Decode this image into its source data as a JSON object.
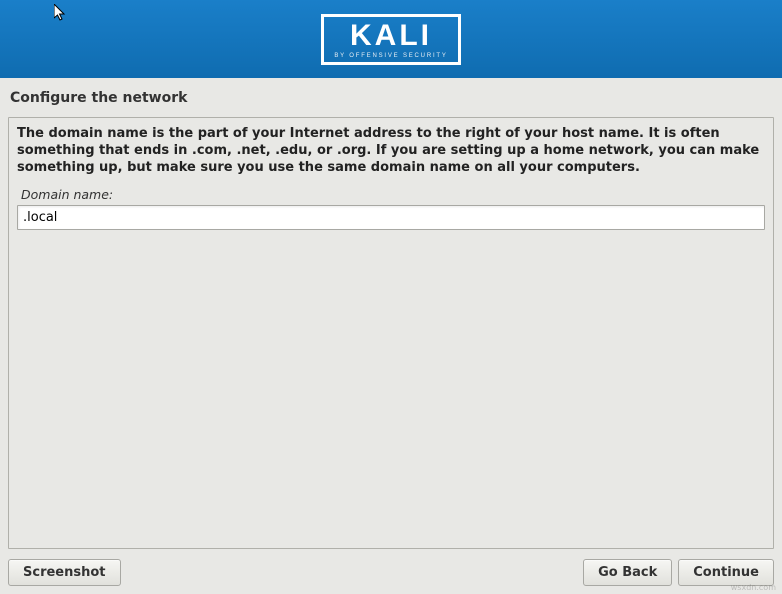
{
  "header": {
    "logo_text": "KALI",
    "logo_sub": "BY OFFENSIVE SECURITY"
  },
  "page": {
    "title": "Configure the network"
  },
  "content": {
    "description": "The domain name is the part of your Internet address to the right of your host name.  It is often something that ends in .com, .net, .edu, or .org.  If you are setting up a home network, you can make something up, but make sure you use the same domain name on all your computers.",
    "field_label": "Domain name:",
    "domain_value": ".local"
  },
  "buttons": {
    "screenshot": "Screenshot",
    "go_back": "Go Back",
    "continue": "Continue"
  },
  "watermark": "wsxdn.com"
}
